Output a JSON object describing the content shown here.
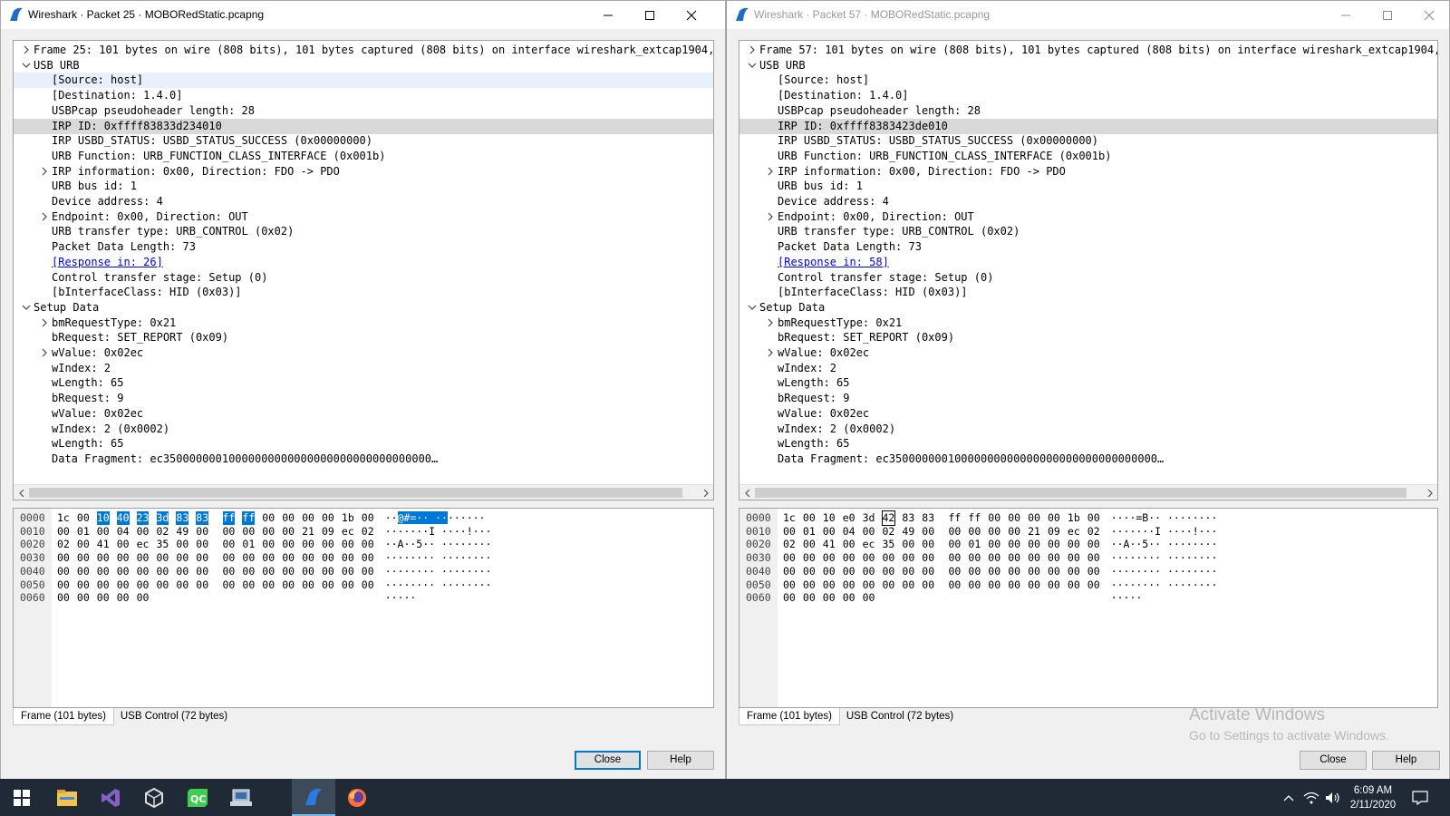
{
  "windows": [
    {
      "title": "Wireshark · Packet 25 · MOBORedStatic.pcapng",
      "tree": [
        {
          "indent": 0,
          "toggle": "collapsed",
          "text": "Frame 25: 101 bytes on wire (808 bits), 101 bytes captured (808 bits) on interface wireshark_extcap1904, id"
        },
        {
          "indent": 0,
          "toggle": "expanded",
          "text": "USB URB"
        },
        {
          "indent": 1,
          "toggle": "none",
          "text": "[Source: host]",
          "state": "hover"
        },
        {
          "indent": 1,
          "toggle": "none",
          "text": "[Destination: 1.4.0]"
        },
        {
          "indent": 1,
          "toggle": "none",
          "text": "USBPcap pseudoheader length: 28"
        },
        {
          "indent": 1,
          "toggle": "none",
          "text": "IRP ID: 0xffff83833d234010",
          "state": "selected"
        },
        {
          "indent": 1,
          "toggle": "none",
          "text": "IRP USBD_STATUS: USBD_STATUS_SUCCESS (0x00000000)"
        },
        {
          "indent": 1,
          "toggle": "none",
          "text": "URB Function: URB_FUNCTION_CLASS_INTERFACE (0x001b)"
        },
        {
          "indent": 1,
          "toggle": "collapsed",
          "text": "IRP information: 0x00, Direction: FDO -> PDO"
        },
        {
          "indent": 1,
          "toggle": "none",
          "text": "URB bus id: 1"
        },
        {
          "indent": 1,
          "toggle": "none",
          "text": "Device address: 4"
        },
        {
          "indent": 1,
          "toggle": "collapsed",
          "text": "Endpoint: 0x00, Direction: OUT"
        },
        {
          "indent": 1,
          "toggle": "none",
          "text": "URB transfer type: URB_CONTROL (0x02)"
        },
        {
          "indent": 1,
          "toggle": "none",
          "text": "Packet Data Length: 73"
        },
        {
          "indent": 1,
          "toggle": "none",
          "text": "[Response in: 26]",
          "link": true
        },
        {
          "indent": 1,
          "toggle": "none",
          "text": "Control transfer stage: Setup (0)"
        },
        {
          "indent": 1,
          "toggle": "none",
          "text": "[bInterfaceClass: HID (0x03)]"
        },
        {
          "indent": 0,
          "toggle": "expanded",
          "text": "Setup Data"
        },
        {
          "indent": 1,
          "toggle": "collapsed",
          "text": "bmRequestType: 0x21"
        },
        {
          "indent": 1,
          "toggle": "none",
          "text": "bRequest: SET_REPORT (0x09)"
        },
        {
          "indent": 1,
          "toggle": "collapsed",
          "text": "wValue: 0x02ec"
        },
        {
          "indent": 1,
          "toggle": "none",
          "text": "wIndex: 2"
        },
        {
          "indent": 1,
          "toggle": "none",
          "text": "wLength: 65"
        },
        {
          "indent": 1,
          "toggle": "none",
          "text": "bRequest: 9"
        },
        {
          "indent": 1,
          "toggle": "none",
          "text": "wValue: 0x02ec"
        },
        {
          "indent": 1,
          "toggle": "none",
          "text": "wIndex: 2 (0x0002)"
        },
        {
          "indent": 1,
          "toggle": "none",
          "text": "wLength: 65"
        },
        {
          "indent": 1,
          "toggle": "none",
          "text": "Data Fragment: ec35000000010000000000000000000000000000000…"
        }
      ],
      "hex": [
        {
          "offset": "0000",
          "bytes": [
            "1c",
            "00",
            "10",
            "40",
            "23",
            "3d",
            "83",
            "83",
            "ff",
            "ff",
            "00",
            "00",
            "00",
            "00",
            "1b",
            "00"
          ],
          "ascii": "··@#=·· ········",
          "hl": [
            2,
            3,
            4,
            5,
            6,
            7,
            8,
            9
          ],
          "asc_hl": [
            2,
            10
          ]
        },
        {
          "offset": "0010",
          "bytes": [
            "00",
            "01",
            "00",
            "04",
            "00",
            "02",
            "49",
            "00",
            "00",
            "00",
            "00",
            "00",
            "21",
            "09",
            "ec",
            "02"
          ],
          "ascii": "·······I ····!···"
        },
        {
          "offset": "0020",
          "bytes": [
            "02",
            "00",
            "41",
            "00",
            "ec",
            "35",
            "00",
            "00",
            "00",
            "01",
            "00",
            "00",
            "00",
            "00",
            "00",
            "00"
          ],
          "ascii": "··A··5·· ········"
        },
        {
          "offset": "0030",
          "bytes": [
            "00",
            "00",
            "00",
            "00",
            "00",
            "00",
            "00",
            "00",
            "00",
            "00",
            "00",
            "00",
            "00",
            "00",
            "00",
            "00"
          ],
          "ascii": "········ ········"
        },
        {
          "offset": "0040",
          "bytes": [
            "00",
            "00",
            "00",
            "00",
            "00",
            "00",
            "00",
            "00",
            "00",
            "00",
            "00",
            "00",
            "00",
            "00",
            "00",
            "00"
          ],
          "ascii": "········ ········"
        },
        {
          "offset": "0050",
          "bytes": [
            "00",
            "00",
            "00",
            "00",
            "00",
            "00",
            "00",
            "00",
            "00",
            "00",
            "00",
            "00",
            "00",
            "00",
            "00",
            "00"
          ],
          "ascii": "········ ········"
        },
        {
          "offset": "0060",
          "bytes": [
            "00",
            "00",
            "00",
            "00",
            "00"
          ],
          "ascii": "·····"
        }
      ],
      "tabs": [
        "Frame (101 bytes)",
        "USB Control (72 bytes)"
      ],
      "close_label": "Close",
      "help_label": "Help"
    },
    {
      "title": "Wireshark · Packet 57 · MOBORedStatic.pcapng",
      "tree": [
        {
          "indent": 0,
          "toggle": "collapsed",
          "text": "Frame 57: 101 bytes on wire (808 bits), 101 bytes captured (808 bits) on interface wireshark_extcap1904, id"
        },
        {
          "indent": 0,
          "toggle": "expanded",
          "text": "USB URB"
        },
        {
          "indent": 1,
          "toggle": "none",
          "text": "[Source: host]"
        },
        {
          "indent": 1,
          "toggle": "none",
          "text": "[Destination: 1.4.0]"
        },
        {
          "indent": 1,
          "toggle": "none",
          "text": "USBPcap pseudoheader length: 28"
        },
        {
          "indent": 1,
          "toggle": "none",
          "text": "IRP ID: 0xffff8383423de010",
          "state": "selected"
        },
        {
          "indent": 1,
          "toggle": "none",
          "text": "IRP USBD_STATUS: USBD_STATUS_SUCCESS (0x00000000)"
        },
        {
          "indent": 1,
          "toggle": "none",
          "text": "URB Function: URB_FUNCTION_CLASS_INTERFACE (0x001b)"
        },
        {
          "indent": 1,
          "toggle": "collapsed",
          "text": "IRP information: 0x00, Direction: FDO -> PDO"
        },
        {
          "indent": 1,
          "toggle": "none",
          "text": "URB bus id: 1"
        },
        {
          "indent": 1,
          "toggle": "none",
          "text": "Device address: 4"
        },
        {
          "indent": 1,
          "toggle": "collapsed",
          "text": "Endpoint: 0x00, Direction: OUT"
        },
        {
          "indent": 1,
          "toggle": "none",
          "text": "URB transfer type: URB_CONTROL (0x02)"
        },
        {
          "indent": 1,
          "toggle": "none",
          "text": "Packet Data Length: 73"
        },
        {
          "indent": 1,
          "toggle": "none",
          "text": "[Response in: 58]",
          "link": true
        },
        {
          "indent": 1,
          "toggle": "none",
          "text": "Control transfer stage: Setup (0)"
        },
        {
          "indent": 1,
          "toggle": "none",
          "text": "[bInterfaceClass: HID (0x03)]"
        },
        {
          "indent": 0,
          "toggle": "expanded",
          "text": "Setup Data"
        },
        {
          "indent": 1,
          "toggle": "collapsed",
          "text": "bmRequestType: 0x21"
        },
        {
          "indent": 1,
          "toggle": "none",
          "text": "bRequest: SET_REPORT (0x09)"
        },
        {
          "indent": 1,
          "toggle": "collapsed",
          "text": "wValue: 0x02ec"
        },
        {
          "indent": 1,
          "toggle": "none",
          "text": "wIndex: 2"
        },
        {
          "indent": 1,
          "toggle": "none",
          "text": "wLength: 65"
        },
        {
          "indent": 1,
          "toggle": "none",
          "text": "bRequest: 9"
        },
        {
          "indent": 1,
          "toggle": "none",
          "text": "wValue: 0x02ec"
        },
        {
          "indent": 1,
          "toggle": "none",
          "text": "wIndex: 2 (0x0002)"
        },
        {
          "indent": 1,
          "toggle": "none",
          "text": "wLength: 65"
        },
        {
          "indent": 1,
          "toggle": "none",
          "text": "Data Fragment: ec35000000010000000000000000000000000000000…"
        }
      ],
      "hex": [
        {
          "offset": "0000",
          "bytes": [
            "1c",
            "00",
            "10",
            "e0",
            "3d",
            "42",
            "83",
            "83",
            "ff",
            "ff",
            "00",
            "00",
            "00",
            "00",
            "1b",
            "00"
          ],
          "ascii": "····=B·· ········",
          "boxed": [
            5
          ]
        },
        {
          "offset": "0010",
          "bytes": [
            "00",
            "01",
            "00",
            "04",
            "00",
            "02",
            "49",
            "00",
            "00",
            "00",
            "00",
            "00",
            "21",
            "09",
            "ec",
            "02"
          ],
          "ascii": "·······I ····!···"
        },
        {
          "offset": "0020",
          "bytes": [
            "02",
            "00",
            "41",
            "00",
            "ec",
            "35",
            "00",
            "00",
            "00",
            "01",
            "00",
            "00",
            "00",
            "00",
            "00",
            "00"
          ],
          "ascii": "··A··5·· ········"
        },
        {
          "offset": "0030",
          "bytes": [
            "00",
            "00",
            "00",
            "00",
            "00",
            "00",
            "00",
            "00",
            "00",
            "00",
            "00",
            "00",
            "00",
            "00",
            "00",
            "00"
          ],
          "ascii": "········ ········"
        },
        {
          "offset": "0040",
          "bytes": [
            "00",
            "00",
            "00",
            "00",
            "00",
            "00",
            "00",
            "00",
            "00",
            "00",
            "00",
            "00",
            "00",
            "00",
            "00",
            "00"
          ],
          "ascii": "········ ········"
        },
        {
          "offset": "0050",
          "bytes": [
            "00",
            "00",
            "00",
            "00",
            "00",
            "00",
            "00",
            "00",
            "00",
            "00",
            "00",
            "00",
            "00",
            "00",
            "00",
            "00"
          ],
          "ascii": "········ ········"
        },
        {
          "offset": "0060",
          "bytes": [
            "00",
            "00",
            "00",
            "00",
            "00"
          ],
          "ascii": "·····"
        }
      ],
      "tabs": [
        "Frame (101 bytes)",
        "USB Control (72 bytes)"
      ],
      "close_label": "Close",
      "help_label": "Help"
    }
  ],
  "watermark": {
    "line1": "Activate Windows",
    "line2": "Go to Settings to activate Windows."
  },
  "taskbar": {
    "apps": [
      "start-icon",
      "file-explorer-icon",
      "visual-studio-icon",
      "unity-icon",
      "qt-creator-icon",
      "network-app-icon",
      "wireshark-icon",
      "firefox-icon"
    ],
    "active_app": "wireshark-icon",
    "time": "6:09 AM",
    "date": "2/11/2020"
  },
  "colors": {
    "selection_blue": "#0078d7",
    "taskbar": "#1f2a36",
    "link": "#0000ee"
  }
}
